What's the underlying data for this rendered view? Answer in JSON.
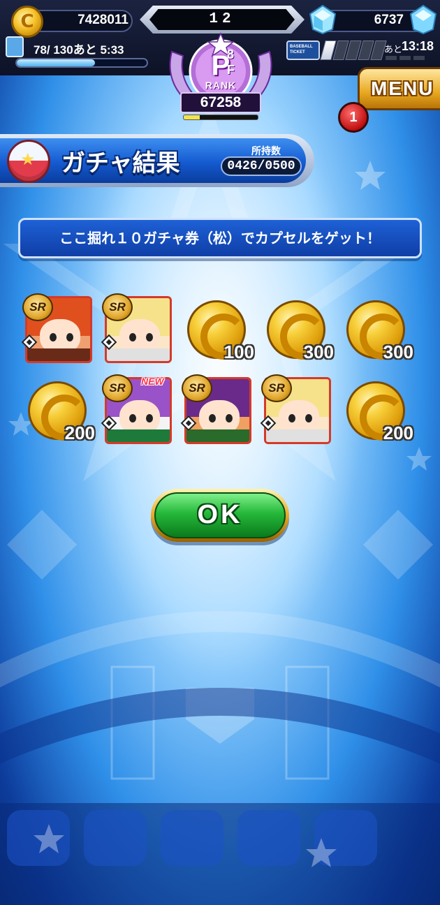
{
  "status": {
    "coins": "7428011",
    "level": "12",
    "gems": "6737",
    "stamina": "78/ 130",
    "stamina_recover": "あと 5:33",
    "stamina_fill": 0.6,
    "ticket_label_1": "BASEBALL",
    "ticket_label_2": "TICKET",
    "ticket_count": 1,
    "ticket_max": 5,
    "ticket_recover_label": "あと",
    "ticket_recover_time": "13:18"
  },
  "rank": {
    "letter": "P",
    "sup": "8",
    "sub": "F",
    "word": "RANK",
    "score": "67258",
    "progress": 0.22
  },
  "menu": {
    "label": "MENU",
    "notification_count": "1"
  },
  "header": {
    "title": "ガチャ結果",
    "holding_label": "所持数",
    "holding_value": "0426/0500"
  },
  "message": "ここ掘れ１０ガチャ券（松）でカプセルをゲット！",
  "results": [
    {
      "type": "card",
      "rarity": "SR",
      "is_new": false,
      "character": "red-haired-player"
    },
    {
      "type": "card",
      "rarity": "SR",
      "is_new": false,
      "character": "blonde-girl"
    },
    {
      "type": "coin",
      "amount": "100"
    },
    {
      "type": "coin",
      "amount": "300"
    },
    {
      "type": "coin",
      "amount": "300"
    },
    {
      "type": "coin",
      "amount": "200"
    },
    {
      "type": "card",
      "rarity": "SR",
      "is_new": true,
      "new_label": "NEW",
      "character": "purple-haired-player"
    },
    {
      "type": "card",
      "rarity": "SR",
      "is_new": false,
      "character": "purple-haired-boy"
    },
    {
      "type": "card",
      "rarity": "SR",
      "is_new": false,
      "character": "blonde-girl"
    },
    {
      "type": "coin",
      "amount": "200"
    }
  ],
  "ok_button": "OK",
  "colors": {
    "accent_blue": "#145ad0",
    "ok_green": "#25b83a",
    "gold": "#e0a10e",
    "card_border": "#d43a2a"
  }
}
